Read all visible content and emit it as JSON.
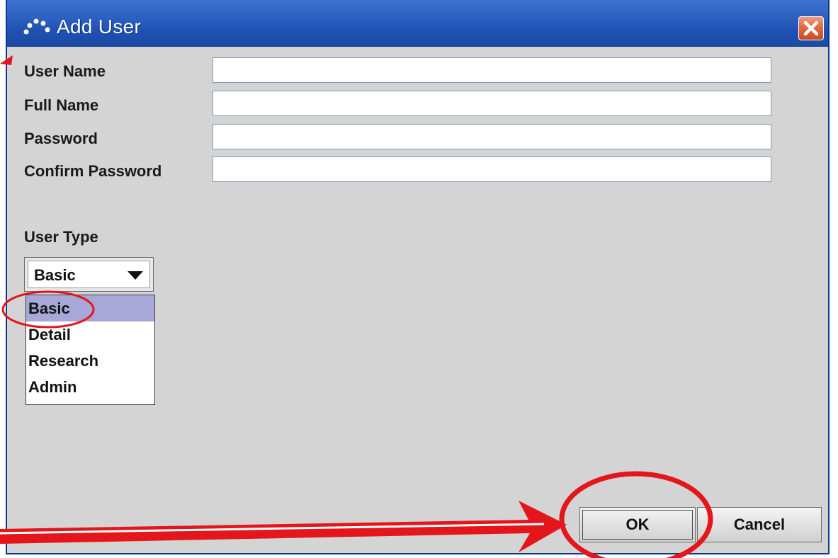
{
  "window": {
    "title": "Add User",
    "icon": "app-dots-icon",
    "close_icon": "close-x-icon"
  },
  "form": {
    "user_name_label": "User Name",
    "user_name_value": "",
    "full_name_label": "Full Name",
    "full_name_value": "",
    "password_label": "Password",
    "password_value": "",
    "confirm_password_label": "Confirm Password",
    "confirm_password_value": "",
    "user_type_label": "User Type",
    "user_type_selected": "Basic",
    "user_type_options": [
      "Basic",
      "Detail",
      "Research",
      "Admin"
    ]
  },
  "buttons": {
    "ok_label": "OK",
    "cancel_label": "Cancel"
  },
  "colors": {
    "titlebar": "#2e62c3",
    "dialog_background": "#d4d4d4",
    "selected_option": "#a8a8d8",
    "annotation": "#e4161b"
  }
}
